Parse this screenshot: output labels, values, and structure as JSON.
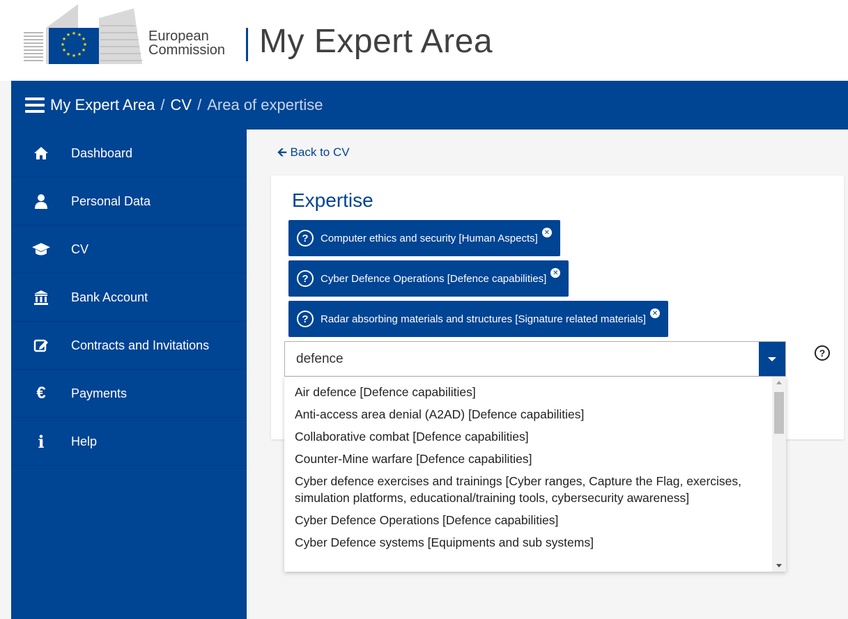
{
  "header": {
    "org_line1": "European",
    "org_line2": "Commission",
    "app_title": "My Expert Area",
    "brand_color": "#004494"
  },
  "breadcrumb": {
    "items": [
      "My Expert Area",
      "CV"
    ],
    "separator": "/",
    "current": "Area of expertise"
  },
  "sidebar": {
    "items": [
      {
        "label": "Dashboard",
        "icon": "home-icon"
      },
      {
        "label": "Personal Data",
        "icon": "user-icon"
      },
      {
        "label": "CV",
        "icon": "graduation-cap-icon"
      },
      {
        "label": "Bank Account",
        "icon": "bank-icon"
      },
      {
        "label": "Contracts and Invitations",
        "icon": "edit-icon"
      },
      {
        "label": "Payments",
        "icon": "euro-icon"
      },
      {
        "label": "Help",
        "icon": "info-icon"
      }
    ]
  },
  "main": {
    "back_label": "Back to CV",
    "panel_title": "Expertise",
    "tags": [
      "Computer ethics and security [Human Aspects]",
      "Cyber Defence Operations [Defence capabilities]",
      "Radar absorbing materials and structures [Signature related materials]"
    ],
    "search_value": "defence",
    "options": [
      "Air defence [Defence capabilities]",
      "Anti-access area denial (A2AD) [Defence capabilities]",
      "Collaborative combat [Defence capabilities]",
      "Counter-Mine warfare [Defence capabilities]",
      "Cyber defence exercises and trainings [Cyber ranges, Capture the Flag, exercises, simulation platforms, educational/training tools, cybersecurity awareness]",
      "Cyber Defence Operations [Defence capabilities]",
      "Cyber Defence systems [Equipments and sub systems]"
    ]
  }
}
